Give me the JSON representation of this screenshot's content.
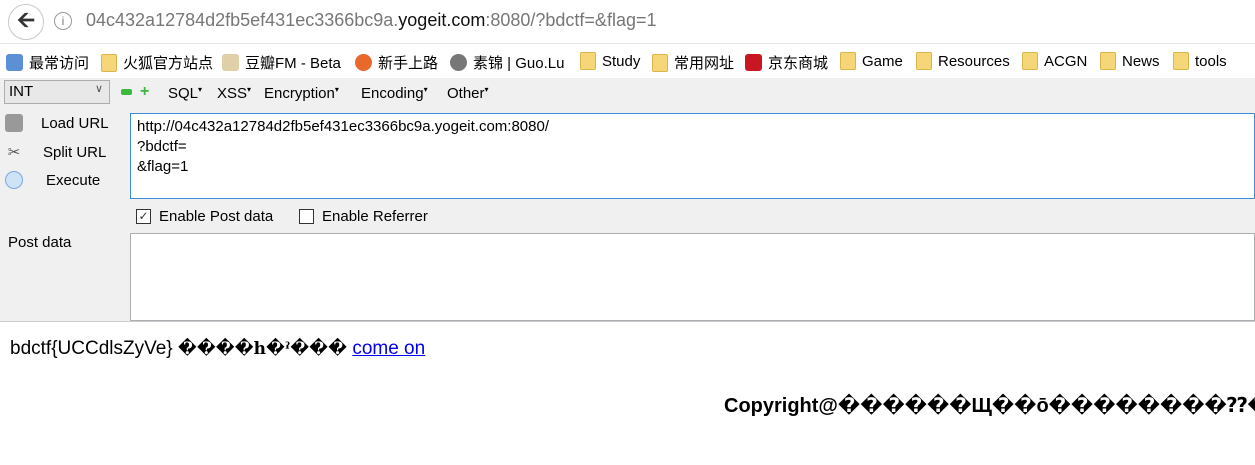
{
  "urlbar": {
    "url_dim_prefix": "04c432a12784d2fb5ef431ec3366bc9a.",
    "url_host": "yogeit.com",
    "url_suffix": ":8080/?bdctf=&flag=1",
    "back_icon": "arrow-left-icon",
    "info_icon": "info-icon"
  },
  "bookmarks": [
    {
      "label": "最常访问",
      "icon": "most-visited-icon"
    },
    {
      "label": "火狐官方站点",
      "icon": "folder-icon"
    },
    {
      "label": "豆瓣FM - Beta",
      "icon": "douban-icon"
    },
    {
      "label": "新手上路",
      "icon": "firefox-icon"
    },
    {
      "label": "素锦 | Guo.Lu",
      "icon": "globe-icon"
    },
    {
      "label": "Study",
      "icon": "folder-icon"
    },
    {
      "label": "常用网址",
      "icon": "folder-icon"
    },
    {
      "label": "京东商城",
      "icon": "jd-icon"
    },
    {
      "label": "Game",
      "icon": "folder-icon"
    },
    {
      "label": "Resources",
      "icon": "folder-icon"
    },
    {
      "label": "ACGN",
      "icon": "folder-icon"
    },
    {
      "label": "News",
      "icon": "folder-icon"
    },
    {
      "label": "tools",
      "icon": "folder-icon"
    }
  ],
  "hackbar": {
    "type_select": "INT",
    "menus": [
      "SQL",
      "XSS",
      "Encryption",
      "Encoding",
      "Other"
    ],
    "load_url": "Load URL",
    "split_url": "Split URL",
    "execute": "Execute",
    "url_value": "http://04c432a12784d2fb5ef431ec3366bc9a.yogeit.com:8080/\n?bdctf=\n&flag=1",
    "enable_post": "Enable Post data",
    "enable_post_checked": true,
    "enable_referrer": "Enable Referrer",
    "enable_referrer_checked": false,
    "post_label": "Post data",
    "post_value": ""
  },
  "page": {
    "flag_text": "bdctf{UCCdlsZyVe}",
    "garbled_text": "����h�ˀ���",
    "link": "come on",
    "copyright": "Copyright@������Щ��ō��������⁇�_"
  }
}
